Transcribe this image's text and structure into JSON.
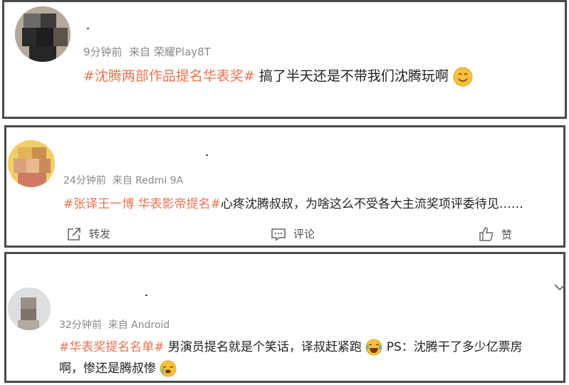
{
  "posts": [
    {
      "meta": "9分钟前  来自 荣耀Play8T",
      "tag": "#沈腾两部作品提名华表奖#",
      "text": " 搞了半天还是不带我们沈腾玩啊",
      "emoji": "smile-emoji"
    },
    {
      "meta": "24分钟前  来自 Redmi 9A",
      "tag": "#张译王一博 华表影帝提名#",
      "text": "心疼沈腾叔叔，为啥这么不受各大主流奖项评委待见……",
      "actions": {
        "repost": "转发",
        "comment": "评论",
        "like": "赞"
      }
    },
    {
      "meta": "32分钟前  来自 Android",
      "tag": "#华表奖提名名单#",
      "text_line1": " 男演员提名就是个笑话，译叔赶紧跑",
      "text_line1b": "PS：沈腾干了多少亿票房",
      "text_line2": "啊，惨还是腾叔惨",
      "emojis": [
        "laugh-cry-emoji",
        "crying-emoji"
      ]
    }
  ]
}
